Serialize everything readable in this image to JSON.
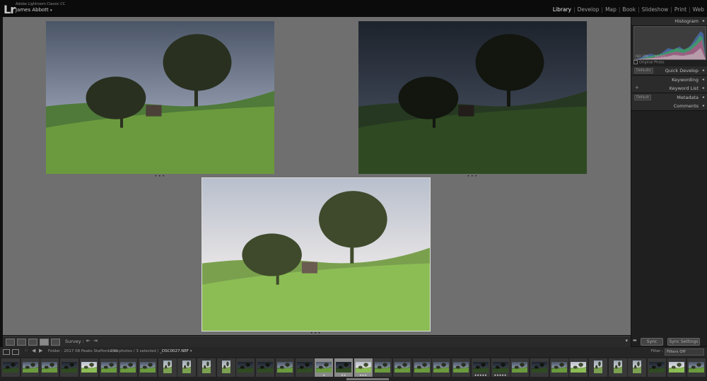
{
  "app": {
    "logo": "Lr",
    "subtitle": "Adobe Lightroom Classic CC",
    "user": "James Abbott",
    "user_caret": "▾"
  },
  "modules": [
    {
      "label": "Library",
      "active": true
    },
    {
      "label": "Develop",
      "active": false
    },
    {
      "label": "Map",
      "active": false
    },
    {
      "label": "Book",
      "active": false
    },
    {
      "label": "Slideshow",
      "active": false
    },
    {
      "label": "Print",
      "active": false
    },
    {
      "label": "Web",
      "active": false
    }
  ],
  "module_separator": "|",
  "survey": {
    "photos": [
      {
        "name": "survey-photo-1",
        "variant": "normal",
        "selected": false
      },
      {
        "name": "survey-photo-2",
        "variant": "dark",
        "selected": false
      },
      {
        "name": "survey-photo-3",
        "variant": "bright",
        "selected": true
      }
    ]
  },
  "toolbar": {
    "view_icons": [
      "grid-view-icon",
      "loupe-view-icon",
      "compare-view-icon",
      "survey-view-icon",
      "people-view-icon"
    ],
    "survey_label": "Survey :",
    "prev_arrow": "⇤",
    "next_arrow": "⇥",
    "menu_caret": "▾"
  },
  "right_panel": {
    "histogram": {
      "title": "Histogram",
      "caret": "◂"
    },
    "histogram_readout": [
      "ISO 100",
      "16 mm",
      "f/16",
      "1/5 sec"
    ],
    "original_photo": "Original Photo",
    "sections": [
      {
        "title": "Quick Develop",
        "left": "Defaults"
      },
      {
        "title": "Keywording",
        "left": ""
      },
      {
        "title": "Keyword List",
        "left": "+"
      },
      {
        "title": "Metadata",
        "left": "Default"
      },
      {
        "title": "Comments",
        "left": ""
      }
    ],
    "sync_label": "Sync",
    "sync_settings_label": "Sync Settings"
  },
  "film_head": {
    "folder_text": "Folder : 2017 08 Peaks Staffordshire",
    "count_text": "230 photos / 3 selected /",
    "filename": "_DSC0027.NEF",
    "filter_label": "Filter :",
    "filter_value": "Filters Off"
  },
  "filmstrip": {
    "thumbs": [
      {
        "tone": "dark",
        "sel": false,
        "stars": ""
      },
      {
        "tone": "normal",
        "sel": false,
        "stars": ""
      },
      {
        "tone": "normal",
        "sel": false,
        "stars": ""
      },
      {
        "tone": "dark",
        "sel": false,
        "stars": ""
      },
      {
        "tone": "bright",
        "sel": false,
        "stars": ""
      },
      {
        "tone": "normal",
        "sel": false,
        "stars": ""
      },
      {
        "tone": "normal",
        "sel": false,
        "stars": ""
      },
      {
        "tone": "normal",
        "sel": false,
        "stars": ""
      },
      {
        "tone": "portrait",
        "sel": false,
        "stars": ""
      },
      {
        "tone": "portrait",
        "sel": false,
        "stars": ""
      },
      {
        "tone": "portrait",
        "sel": false,
        "stars": ""
      },
      {
        "tone": "portrait",
        "sel": false,
        "stars": ""
      },
      {
        "tone": "dark",
        "sel": false,
        "stars": ""
      },
      {
        "tone": "dark",
        "sel": false,
        "stars": ""
      },
      {
        "tone": "normal",
        "sel": false,
        "stars": ""
      },
      {
        "tone": "dark",
        "sel": false,
        "stars": ""
      },
      {
        "tone": "normal",
        "sel": true,
        "stars": "★"
      },
      {
        "tone": "dark",
        "sel": true,
        "stars": "★★"
      },
      {
        "tone": "bright",
        "sel": true,
        "stars": "★★★"
      },
      {
        "tone": "normal",
        "sel": false,
        "stars": ""
      },
      {
        "tone": "normal",
        "sel": false,
        "stars": ""
      },
      {
        "tone": "normal",
        "sel": false,
        "stars": ""
      },
      {
        "tone": "normal",
        "sel": false,
        "stars": ""
      },
      {
        "tone": "normal",
        "sel": false,
        "stars": ""
      },
      {
        "tone": "dark",
        "sel": false,
        "stars": "★★★★★"
      },
      {
        "tone": "dark",
        "sel": false,
        "stars": "★★★★★"
      },
      {
        "tone": "normal",
        "sel": false,
        "stars": ""
      },
      {
        "tone": "dark",
        "sel": false,
        "stars": ""
      },
      {
        "tone": "normal",
        "sel": false,
        "stars": ""
      },
      {
        "tone": "bright",
        "sel": false,
        "stars": ""
      },
      {
        "tone": "portrait",
        "sel": false,
        "stars": ""
      },
      {
        "tone": "portrait",
        "sel": false,
        "stars": ""
      },
      {
        "tone": "portrait",
        "sel": false,
        "stars": ""
      },
      {
        "tone": "dark",
        "sel": false,
        "stars": ""
      },
      {
        "tone": "bright",
        "sel": false,
        "stars": ""
      },
      {
        "tone": "normal",
        "sel": false,
        "stars": ""
      }
    ]
  },
  "colors": {
    "accent": "#f0f0f0",
    "survey_bg": "#6f6f6f",
    "panel_bg": "#1f1f1f"
  }
}
